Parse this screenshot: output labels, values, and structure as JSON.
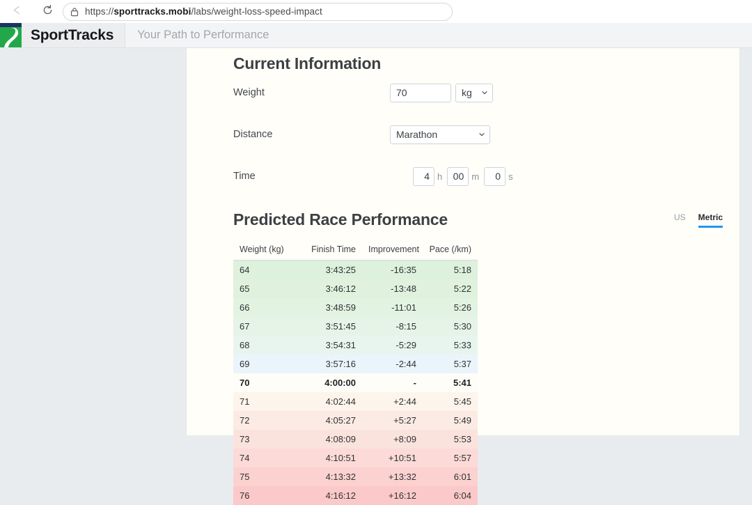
{
  "browser": {
    "back_icon": "back-arrow-icon",
    "reload_icon": "reload-icon",
    "lock_icon": "lock-icon",
    "url_prefix": "https://",
    "url_domain": "sporttracks.mobi",
    "url_path": "/labs/weight-loss-speed-impact",
    "url_full": "https://sporttracks.mobi/labs/weight-loss-speed-impact"
  },
  "header": {
    "logo_icon": "sporttracks-logo-icon",
    "brand": "SportTracks",
    "tagline": "Your Path to Performance",
    "logo_navy": "#1d3461",
    "logo_green": "#22a84a"
  },
  "current_information": {
    "title": "Current Information",
    "weight_label": "Weight",
    "weight_value": "70",
    "weight_unit": "kg",
    "distance_label": "Distance",
    "distance_value": "Marathon",
    "time_label": "Time",
    "hours": "4",
    "hours_unit": "h",
    "minutes": "00",
    "minutes_unit": "m",
    "seconds": "0",
    "seconds_unit": "s"
  },
  "predicted": {
    "title": "Predicted Race Performance",
    "tab_us": "US",
    "tab_metric": "Metric",
    "active_tab": "Metric",
    "accent_color": "#2196f3"
  },
  "chart_data": {
    "type": "table",
    "title": "Predicted Race Performance",
    "columns": [
      "Weight (kg)",
      "Finish Time",
      "Improvement",
      "Pace (/km)"
    ],
    "highlight_row_index": 6,
    "rows": [
      {
        "weight": "64",
        "finish": "3:43:25",
        "improvement": "-16:35",
        "pace": "5:18",
        "bg": "#ddf1dc"
      },
      {
        "weight": "65",
        "finish": "3:46:12",
        "improvement": "-13:48",
        "pace": "5:22",
        "bg": "#e0f2de"
      },
      {
        "weight": "66",
        "finish": "3:48:59",
        "improvement": "-11:01",
        "pace": "5:26",
        "bg": "#e3f3e2"
      },
      {
        "weight": "67",
        "finish": "3:51:45",
        "improvement": "-8:15",
        "pace": "5:30",
        "bg": "#e6f4e8"
      },
      {
        "weight": "68",
        "finish": "3:54:31",
        "improvement": "-5:29",
        "pace": "5:33",
        "bg": "#e8f5ef"
      },
      {
        "weight": "69",
        "finish": "3:57:16",
        "improvement": "-2:44",
        "pace": "5:37",
        "bg": "#eaf4fb"
      },
      {
        "weight": "70",
        "finish": "4:00:00",
        "improvement": "-",
        "pace": "5:41",
        "bg": "#fefdf8"
      },
      {
        "weight": "71",
        "finish": "4:02:44",
        "improvement": "+2:44",
        "pace": "5:45",
        "bg": "#fdf4ec"
      },
      {
        "weight": "72",
        "finish": "4:05:27",
        "improvement": "+5:27",
        "pace": "5:49",
        "bg": "#fcebe4"
      },
      {
        "weight": "73",
        "finish": "4:08:09",
        "improvement": "+8:09",
        "pace": "5:53",
        "bg": "#fbe3dd"
      },
      {
        "weight": "74",
        "finish": "4:10:51",
        "improvement": "+10:51",
        "pace": "5:57",
        "bg": "#fbdad7"
      },
      {
        "weight": "75",
        "finish": "4:13:32",
        "improvement": "+13:32",
        "pace": "6:01",
        "bg": "#fbd2d0"
      },
      {
        "weight": "76",
        "finish": "4:16:12",
        "improvement": "+16:12",
        "pace": "6:04",
        "bg": "#fbc9c9"
      }
    ]
  }
}
